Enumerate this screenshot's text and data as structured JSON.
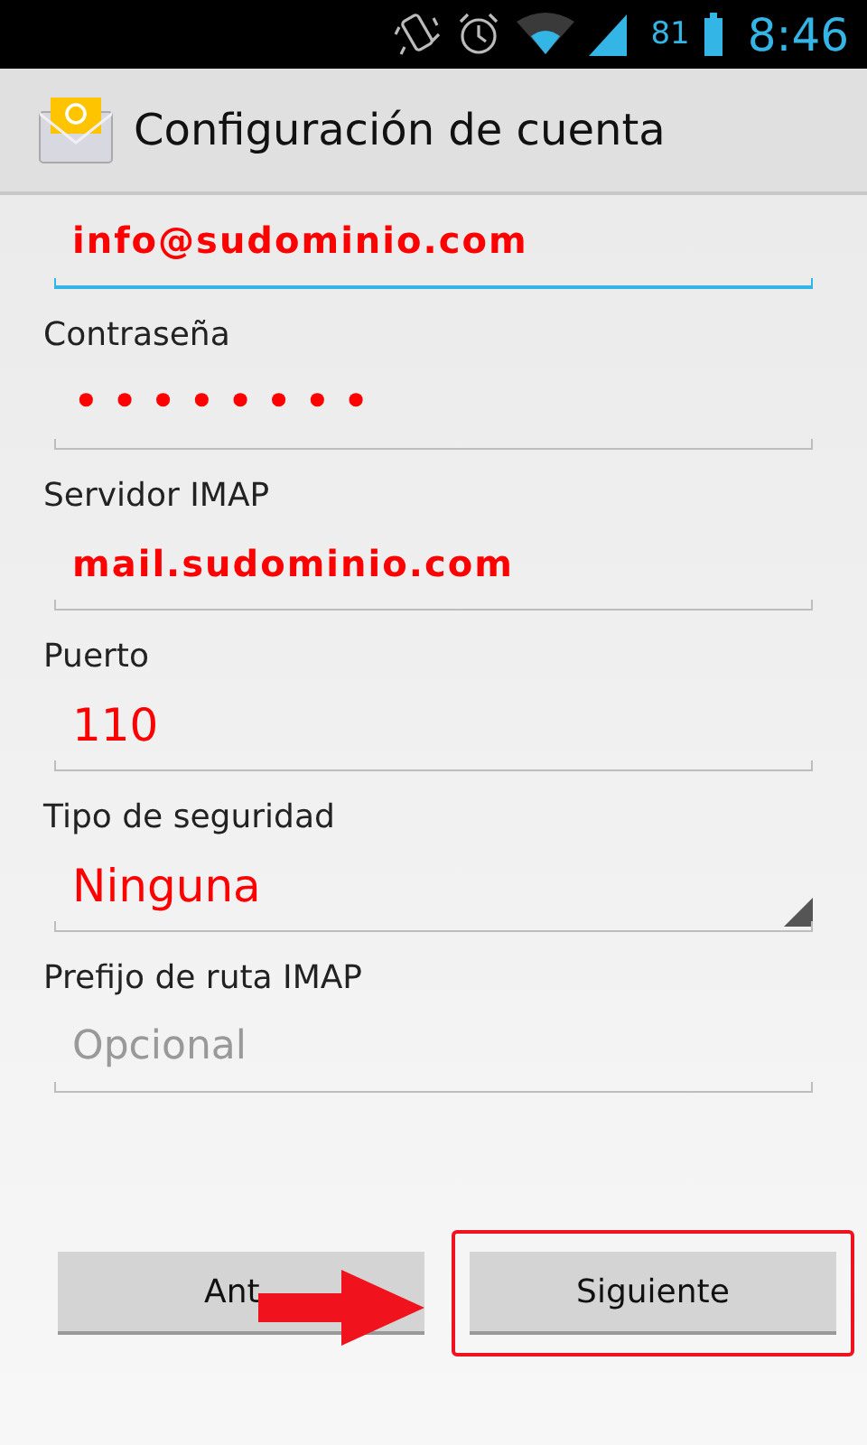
{
  "status_bar": {
    "battery": "81",
    "time": "8:46"
  },
  "title": "Configuración de cuenta",
  "fields": [
    {
      "kind": "text",
      "value": "info@sudominio.com",
      "focused": true
    },
    {
      "label": "Contraseña",
      "kind": "password",
      "value": "••••••••",
      "focused": false
    },
    {
      "label": "Servidor IMAP",
      "kind": "text",
      "value": "mail.sudominio.com",
      "focused": false
    },
    {
      "label": "Puerto",
      "kind": "number",
      "value": "110",
      "focused": false
    },
    {
      "label": "Tipo de seguridad",
      "kind": "select",
      "value": "Ninguna",
      "focused": false
    },
    {
      "label": "Prefijo de ruta IMAP",
      "kind": "text",
      "placeholder": "Opcional",
      "focused": false
    }
  ],
  "buttons": [
    {
      "label": "Ant",
      "highlighted": false
    },
    {
      "label": "Siguiente",
      "highlighted": true
    }
  ]
}
